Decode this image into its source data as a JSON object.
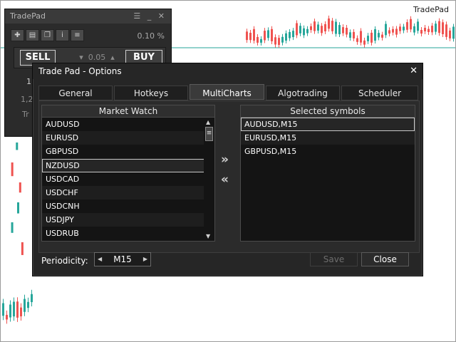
{
  "chart_brand": "TradePad",
  "colors": {
    "bull": "#26a69a",
    "bear": "#ef5350",
    "level_line": "#26a69a",
    "dialog_bg": "#262626",
    "list_bg": "#141414"
  },
  "tradepad": {
    "title": "TradePad",
    "toolbar_icons": [
      "plus-icon",
      "layers-icon",
      "copy-icon",
      "info-icon",
      "list-icon"
    ],
    "percent": "0.10 %",
    "sell_label": "SELL",
    "buy_label": "BUY",
    "volume": "0.05",
    "frag_value": "1",
    "frag_price": "1,2",
    "frag_text": "Tr"
  },
  "dialog": {
    "title": "Trade Pad - Options",
    "tabs": [
      {
        "label": "General"
      },
      {
        "label": "Hotkeys"
      },
      {
        "label": "MultiCharts"
      },
      {
        "label": "Algotrading"
      },
      {
        "label": "Scheduler"
      }
    ],
    "active_tab": "MultiCharts",
    "market_watch": {
      "header": "Market Watch",
      "items": [
        "AUDUSD",
        "EURUSD",
        "GBPUSD",
        "NZDUSD",
        "USDCAD",
        "USDCHF",
        "USDCNH",
        "USDJPY",
        "USDRUB"
      ],
      "selected_index": 3
    },
    "selected_symbols": {
      "header": "Selected symbols",
      "items": [
        "AUDUSD,M15",
        "EURUSD,M15",
        "GBPUSD,M15"
      ],
      "selected_index": 0
    },
    "add_arrow": "»",
    "remove_arrow": "«",
    "periodicity_label": "Periodicity:",
    "periodicity_value": "M15",
    "save_label": "Save",
    "close_label": "Close"
  }
}
